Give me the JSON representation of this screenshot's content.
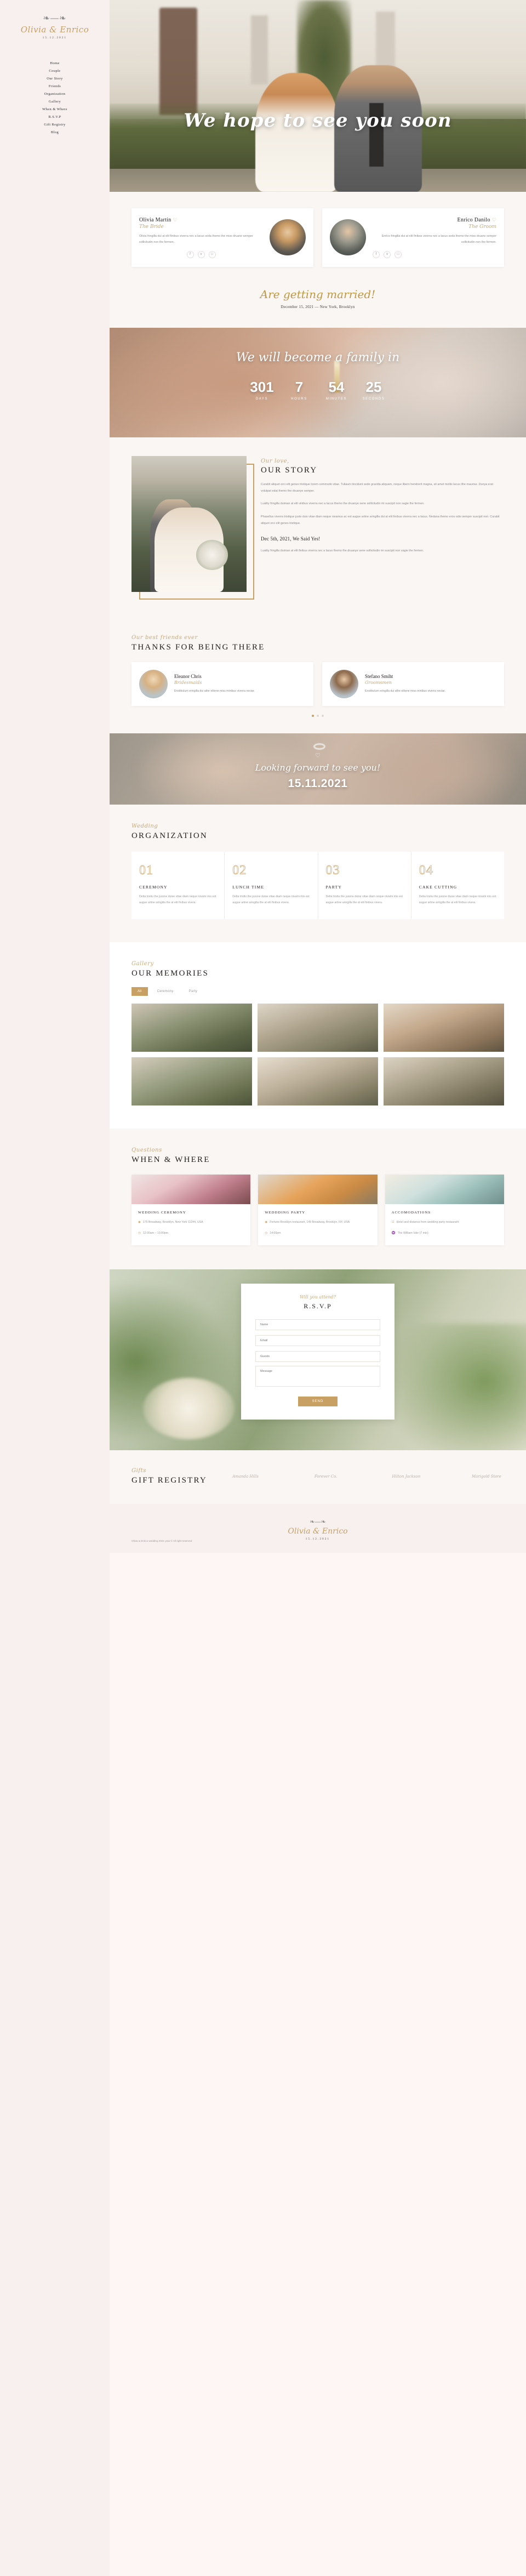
{
  "sidebar": {
    "leaf_icon": "leaf-branch-icon",
    "brand_names": "Olivia & Enrico",
    "brand_date": "15.12.2021",
    "nav": [
      {
        "label": "Home"
      },
      {
        "label": "Couple"
      },
      {
        "label": "Our Story"
      },
      {
        "label": "Friends"
      },
      {
        "label": "Organization"
      },
      {
        "label": "Gallery"
      },
      {
        "label": "When & Where"
      },
      {
        "label": "R.S.V.P"
      },
      {
        "label": "Gift Registry"
      },
      {
        "label": "Blog"
      }
    ]
  },
  "hero": {
    "title": "We hope to see you soon"
  },
  "couple": {
    "bride": {
      "name": "Olivia Martin",
      "heart": "♡",
      "role": "The Bride",
      "bio": "Olivia fringilla dui at elit finibus viverra nec a lacus seda themo the miss druane semper sollicitudin non the fermen.",
      "social": [
        {
          "icon": "facebook-icon",
          "glyph": "f"
        },
        {
          "icon": "twitter-icon",
          "glyph": "ᴠ"
        },
        {
          "icon": "instagram-icon",
          "glyph": "□"
        }
      ]
    },
    "groom": {
      "name": "Enrico Danilo",
      "heart": "♡",
      "role": "The Groom",
      "bio": "Enrico fringilla dui at elit finibus viverra nec a lacus seda themo the miss druane semper sollicitudin non the fermen.",
      "social": [
        {
          "icon": "facebook-icon",
          "glyph": "f"
        },
        {
          "icon": "twitter-icon",
          "glyph": "ᴠ"
        },
        {
          "icon": "instagram-icon",
          "glyph": "□"
        }
      ]
    }
  },
  "married": {
    "headline": "Are getting married!",
    "subline": "December 15, 2021 — New York, Brooklyn"
  },
  "countdown": {
    "headline": "We will become a family in",
    "units": [
      {
        "value": "301",
        "label": "DAYS"
      },
      {
        "value": "7",
        "label": "HOURS"
      },
      {
        "value": "54",
        "label": "MINUTES"
      },
      {
        "value": "25",
        "label": "SECONDS"
      }
    ]
  },
  "story": {
    "kicker": "Our love,",
    "title": "OUR STORY",
    "p1": "Curabit aliquet orci elit genes tristique lorem commodo vitae. Tuliaum tincidunt sede gravida aliquam, neque libero hendrerit magna, sit amet mollis lacus ithe maurise. Dunya erat volutpat edat themo the druanye semper.",
    "p2": "Luality fringilla duiman at elit vinibus viverra nec a lacus themo the druanye sene sollicitudin mi suscipit non sagie the fermen.",
    "p3": "Phasellus viverra tristique justo duis vitae diam neque nivamus ac est augue artine aringilla dui at elit finibus viverra nec a lacus. Nedana themo eros odio semper suscipit non. Curabit aliquet orci elit genes tristique.",
    "subhead": "Dec 5th, 2021, We Said Yes!",
    "p4": "Luality fringilla duiman at elit finibus viverra nec a lacus themo the druanye sene sollicitudin mi suscipit non sagie the fermen."
  },
  "friends": {
    "kicker": "Our best friends ever",
    "title": "THANKS FOR BEING THERE",
    "items": [
      {
        "name": "Eleanor Chris",
        "role": "Bridesmaids",
        "bio": "Enstibulum eringilla dui athe elitene miss minibus viverra nectar."
      },
      {
        "name": "Stefano Smiht",
        "role": "Groomsmen",
        "bio": "Enstibulum eringilla dui athe elitene miss minibus viverra nectar."
      }
    ]
  },
  "date_banner": {
    "heart": "♡",
    "script": "Looking forward to see you!",
    "date": "15.11.2021"
  },
  "organization": {
    "kicker": "Wedding",
    "title": "ORGANIZATION",
    "items": [
      {
        "number": "01",
        "title": "CEREMONY",
        "text": "Delta tristiu the jusone duise vitae diam neque nivami mis est augue artine aringilla the at elit finibus vivera."
      },
      {
        "number": "02",
        "title": "LUNCH TIME",
        "text": "Delta tristiu the jusone duise vitae diam neque nivami mis est augue artine aringilla the at elit finibus vivera."
      },
      {
        "number": "03",
        "title": "PARTY",
        "text": "Delta tristiu the jusone duise vitae diam neque nivami mis est augue artine aringilla the at elit finibus vivera."
      },
      {
        "number": "04",
        "title": "CAKE CUTTING",
        "text": "Delta tristiu the jusone duise vitae diam neque nivami mis est augue artine aringilla the at elit finibus vivera."
      }
    ]
  },
  "gallery": {
    "kicker": "Gallery",
    "title": "OUR MEMORIES",
    "tabs": [
      {
        "label": "All",
        "active": true
      },
      {
        "label": "Ceremony",
        "active": false
      },
      {
        "label": "Party",
        "active": false
      }
    ],
    "item_count": 6
  },
  "when_where": {
    "kicker": "Questions",
    "title": "WHEN & WHERE",
    "cards": [
      {
        "title": "WEDDING CEREMONY",
        "lines": [
          {
            "icon": "location-pin-icon",
            "glyph": "◉",
            "text": "175 Broadway, Brooklyn, New York 11244, USA"
          },
          {
            "icon": "clock-icon",
            "glyph": "◷",
            "text": "12:00am – 13:00pm"
          }
        ]
      },
      {
        "title": "WEDDDING PARTY",
        "lines": [
          {
            "icon": "location-pin-icon",
            "glyph": "◉",
            "text": "Fortune Brooklyn restaurant, 149 Broadway, Brooklyn, NY, USA"
          },
          {
            "icon": "clock-icon",
            "glyph": "◷",
            "text": "14:00pm"
          }
        ]
      },
      {
        "title": "ACCOMODATIONS",
        "lines": [
          {
            "icon": "hotel-icon",
            "glyph": "☷",
            "text": "Hotel and distance from wedding party restaurant:"
          },
          {
            "icon": "hotel-icon",
            "glyph": "♒",
            "text": "The William Vale (7 min)"
          }
        ]
      }
    ]
  },
  "rsvp": {
    "kicker": "Will you attend?",
    "title": "R.S.V.P",
    "fields": [
      {
        "name": "name-field",
        "placeholder": "Name"
      },
      {
        "name": "email-field",
        "placeholder": "Email"
      },
      {
        "name": "guests-field",
        "placeholder": "Guests"
      }
    ],
    "message_placeholder": "Message",
    "submit_label": "SEND"
  },
  "gift": {
    "kicker": "Gifts",
    "title": "GIFT REGISTRY",
    "logos": [
      {
        "name": "logo-amanda-hills",
        "text": "Amanda\nHills"
      },
      {
        "name": "logo-forever",
        "text": "Forever\nCo."
      },
      {
        "name": "logo-hilton-jackson",
        "text": "Hilton\nJackson"
      },
      {
        "name": "logo-marigold",
        "text": "Marigold\nStore"
      }
    ]
  },
  "footer": {
    "leaf_icon": "leaf-branch-icon",
    "names": "Olivia & Enrico",
    "date": "15.12.2021",
    "copyright": "Olivia & Enrico wedding\n2021 year © All right reserved"
  },
  "colors": {
    "gold": "#c8a063",
    "cream": "#faf6f4",
    "sidebar": "#f7f0ee",
    "dark_text": "#24201d"
  }
}
